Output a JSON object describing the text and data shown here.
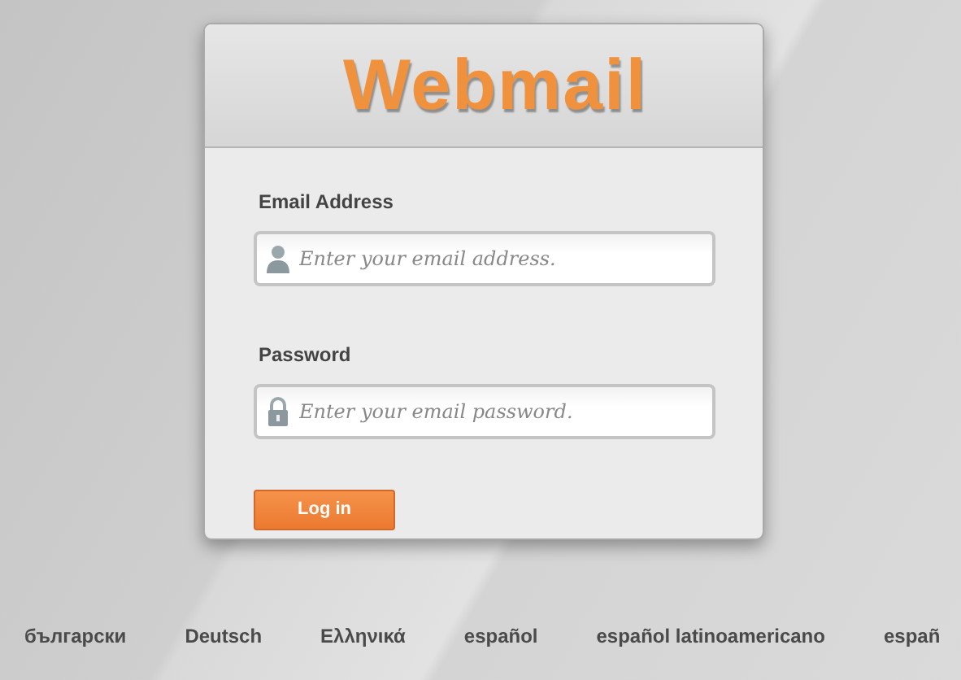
{
  "logo": "Webmail",
  "fields": [
    {
      "label": "Email Address",
      "kind": "user",
      "placeholder": "Enter your email address."
    },
    {
      "label": "Password",
      "kind": "lock",
      "placeholder": "Enter your email password."
    }
  ],
  "button": "Log in",
  "languages": [
    "български",
    "Deutsch",
    "Ελληνικά",
    "español",
    "español latinoamericano",
    "españ"
  ]
}
